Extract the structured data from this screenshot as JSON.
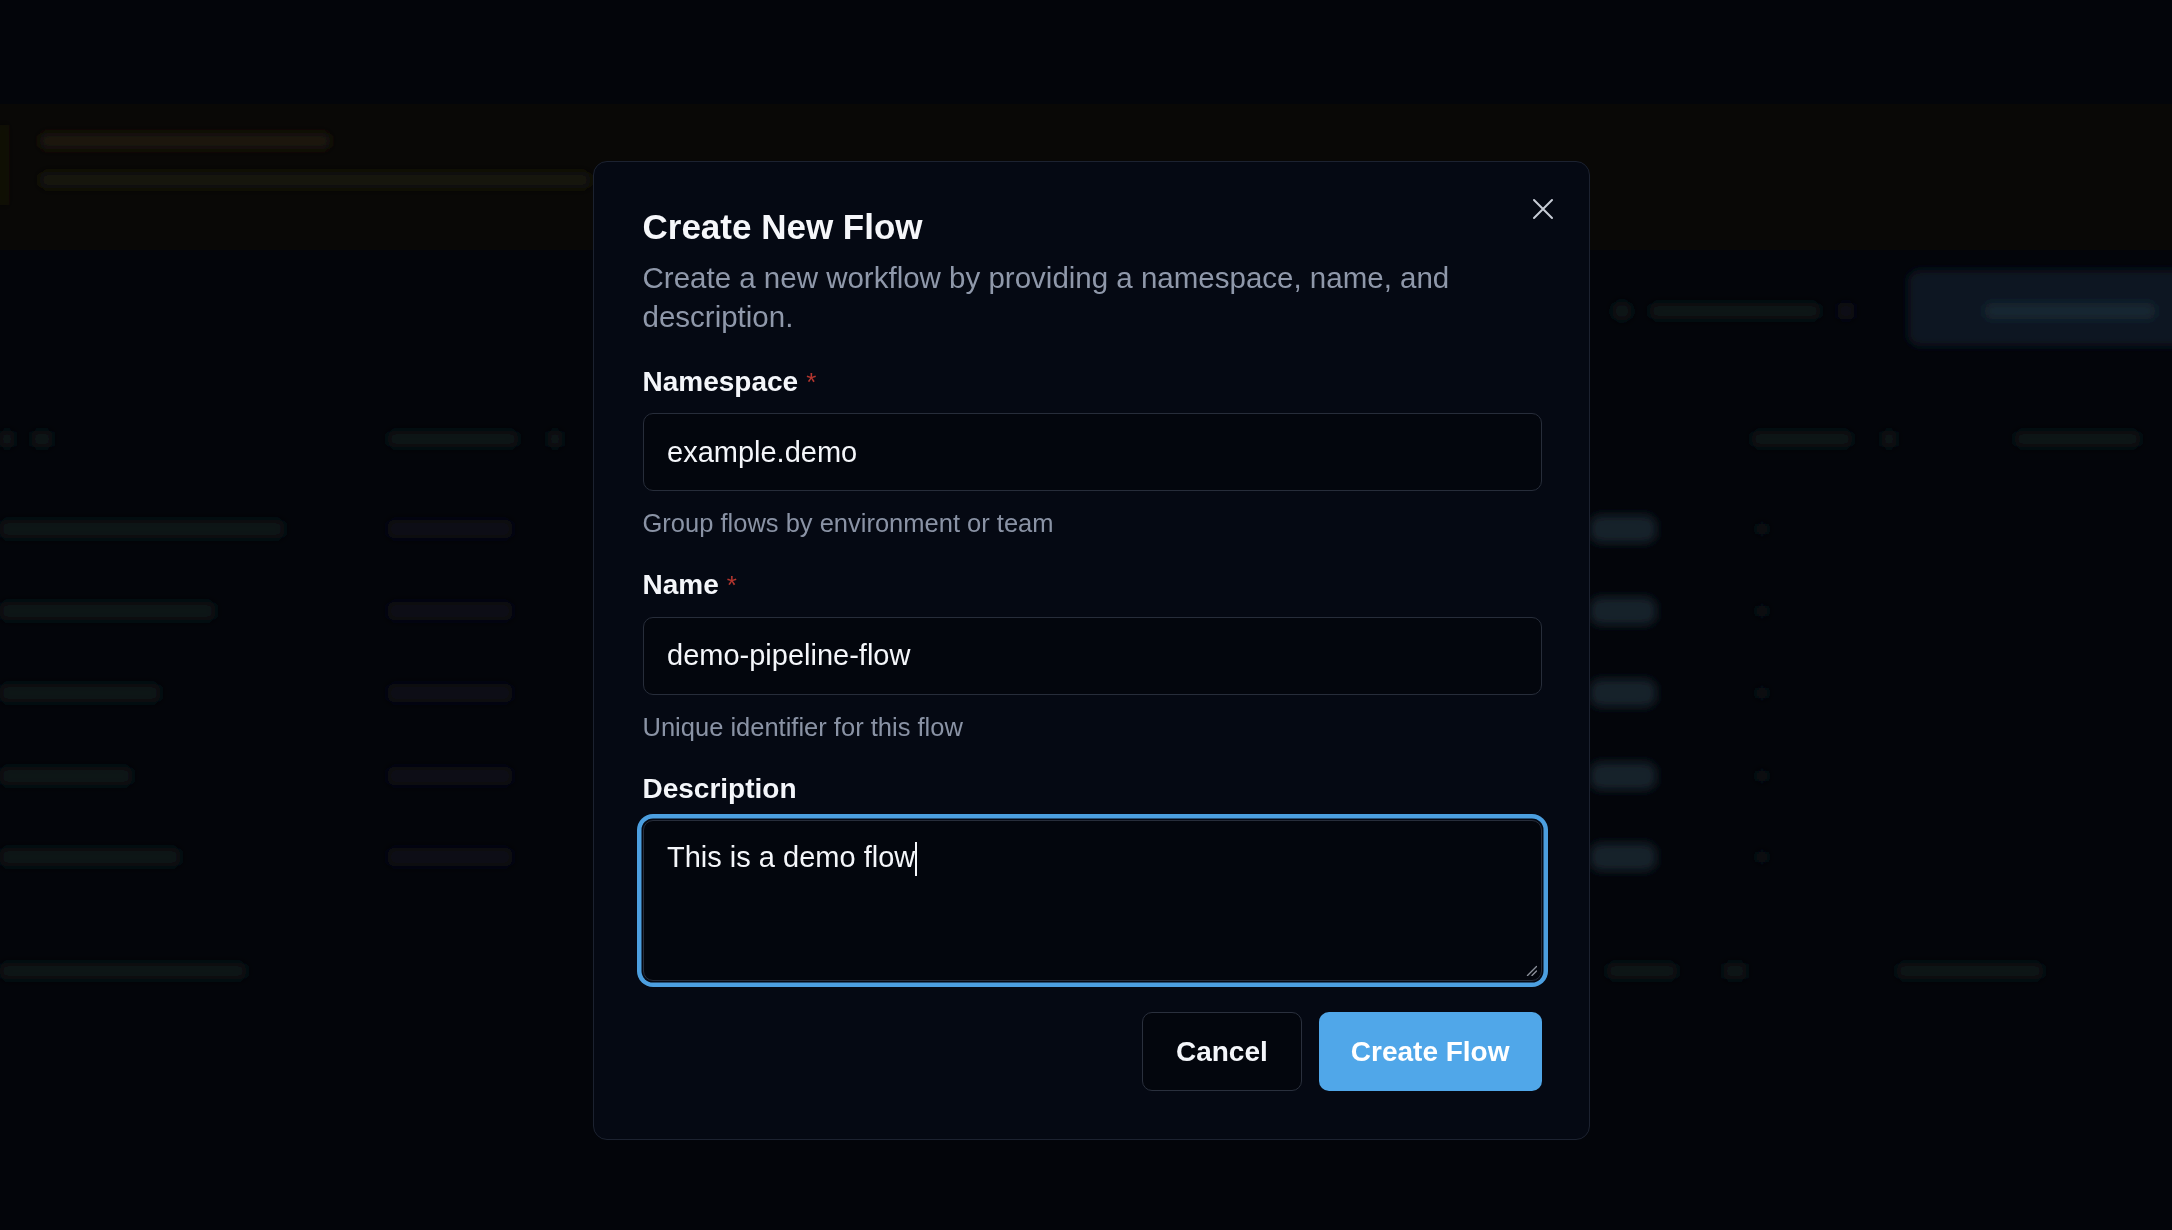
{
  "dialog": {
    "title": "Create New Flow",
    "description": "Create a new workflow by providing a namespace, name, and description.",
    "fields": [
      {
        "kind": "input",
        "label": "Namespace",
        "required_mark": "*",
        "value": "example.demo",
        "helper": "Group flows by environment or team",
        "focused": false
      },
      {
        "kind": "input",
        "label": "Name",
        "required_mark": "*",
        "value": "demo-pipeline-flow",
        "helper": "Unique identifier for this flow",
        "focused": false
      },
      {
        "kind": "textarea",
        "label": "Description",
        "value": "This is a demo flow",
        "focused": true
      }
    ],
    "buttons": [
      {
        "kind": "secondary",
        "label": "Cancel"
      },
      {
        "kind": "primary",
        "label": "Create Flow"
      }
    ]
  }
}
